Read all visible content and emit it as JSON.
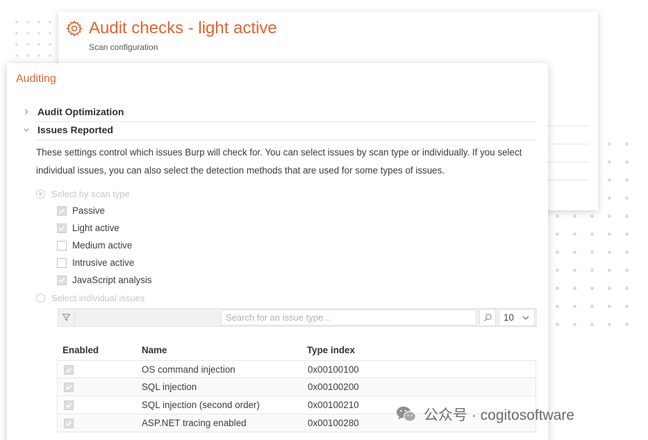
{
  "back_panel": {
    "title": "Audit checks - light active",
    "subtitle": "Scan configuration"
  },
  "front_panel": {
    "section_title": "Auditing",
    "groups": [
      {
        "label": "Audit Optimization",
        "expanded": false
      },
      {
        "label": "Issues Reported",
        "expanded": true
      }
    ],
    "description": "These settings control which issues Burp will check for. You can select issues by scan type or individually. If you select individual issues, you can also select the detection methods that are used for some types of issues.",
    "radio_scan_type": {
      "label": "Select by scan type",
      "selected": true
    },
    "scan_types": [
      {
        "label": "Passive",
        "checked": true
      },
      {
        "label": "Light active",
        "checked": true
      },
      {
        "label": "Medium active",
        "checked": false
      },
      {
        "label": "Intrusive active",
        "checked": false
      },
      {
        "label": "JavaScript analysis",
        "checked": true
      }
    ],
    "radio_individual": {
      "label": "Select individual issues",
      "selected": false
    },
    "search": {
      "placeholder": "Search for an issue type...",
      "value": ""
    },
    "page_size": "10",
    "table": {
      "headers": [
        "Enabled",
        "Name",
        "Type index"
      ],
      "rows": [
        {
          "enabled": true,
          "name": "OS command injection",
          "type_index": "0x00100100"
        },
        {
          "enabled": true,
          "name": "SQL injection",
          "type_index": "0x00100200"
        },
        {
          "enabled": true,
          "name": "SQL injection (second order)",
          "type_index": "0x00100210"
        },
        {
          "enabled": true,
          "name": "ASP.NET tracing enabled",
          "type_index": "0x00100280"
        }
      ]
    }
  },
  "watermark": {
    "text": "公众号 · cogitosoftware"
  },
  "colors": {
    "accent": "#e8622a",
    "disabled_text": "#c8c8c8"
  },
  "icons": [
    "gear-icon",
    "chevron-right-icon",
    "chevron-down-icon",
    "filter-icon",
    "search-icon",
    "dropdown-chevron-icon",
    "checkmark-icon",
    "wechat-icon"
  ]
}
